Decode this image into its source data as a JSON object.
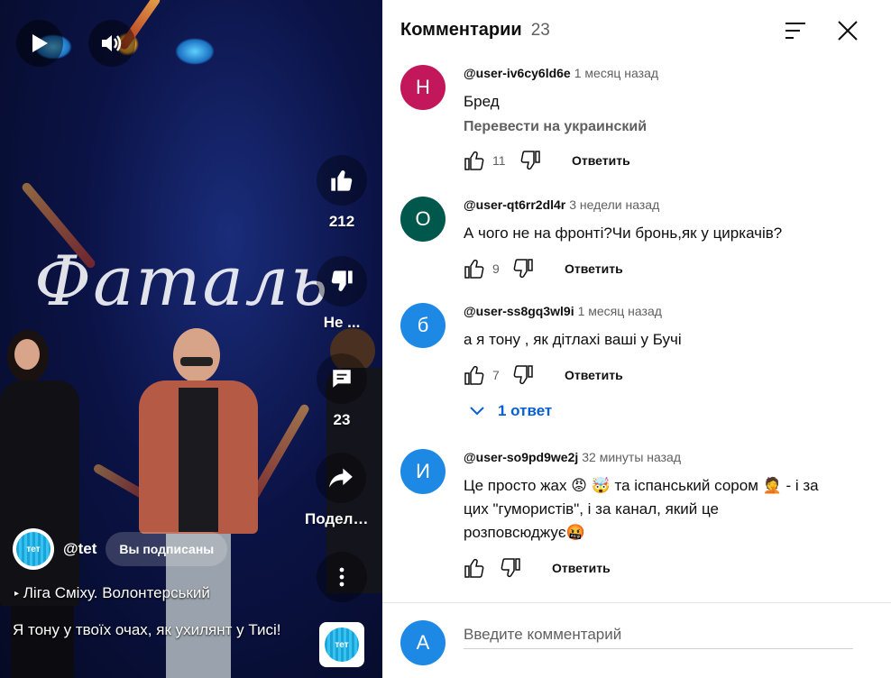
{
  "video": {
    "stage_title": "Фаталь",
    "likes": "212",
    "dislike_label": "Не ...",
    "comments_count": "23",
    "share_label": "Поделиться",
    "channel_handle": "@tet",
    "subscribed_label": "Вы подписаны",
    "playlist": "Ліга Сміху. Волонтерський",
    "caption": "Я тону у твоїх очах, як ухилянт у Тисі!",
    "logo_text": "тет"
  },
  "panel": {
    "title": "Комментарии",
    "count": "23",
    "sort_icon": "sort-icon",
    "close_icon": "close-icon",
    "input_placeholder": "Введите комментарий",
    "input_avatar": "A",
    "input_avatar_color": "#1e88e5"
  },
  "comments": [
    {
      "avatar": "Н",
      "avatar_color": "#c2185b",
      "author": "@user-iv6cy6ld6e",
      "time": "1 месяц назад",
      "text": "Бред",
      "translate": "Перевести на украинский",
      "likes": "11",
      "reply_label": "Ответить"
    },
    {
      "avatar": "О",
      "avatar_color": "#00574b",
      "author": "@user-qt6rr2dl4r",
      "time": "3 недели назад",
      "text": "А чого не на фронті?Чи бронь,як у циркачів?",
      "likes": "9",
      "reply_label": "Ответить"
    },
    {
      "avatar": "б",
      "avatar_color": "#1e88e5",
      "author": "@user-ss8gq3wl9i",
      "time": "1 месяц назад",
      "text": "а я тону , як дітлахі ваші у Бучі",
      "likes": "7",
      "reply_label": "Ответить",
      "replies_label": "1 ответ"
    },
    {
      "avatar": "И",
      "avatar_color": "#1e88e5",
      "author": "@user-so9pd9we2j",
      "time": "32 минуты назад",
      "text": "Це просто жах 😡 🤯  та іспанський сором 🤦  - і за цих \"гумористів\", і за канал, який це розповсюджує🤬",
      "likes": "",
      "reply_label": "Ответить"
    }
  ]
}
